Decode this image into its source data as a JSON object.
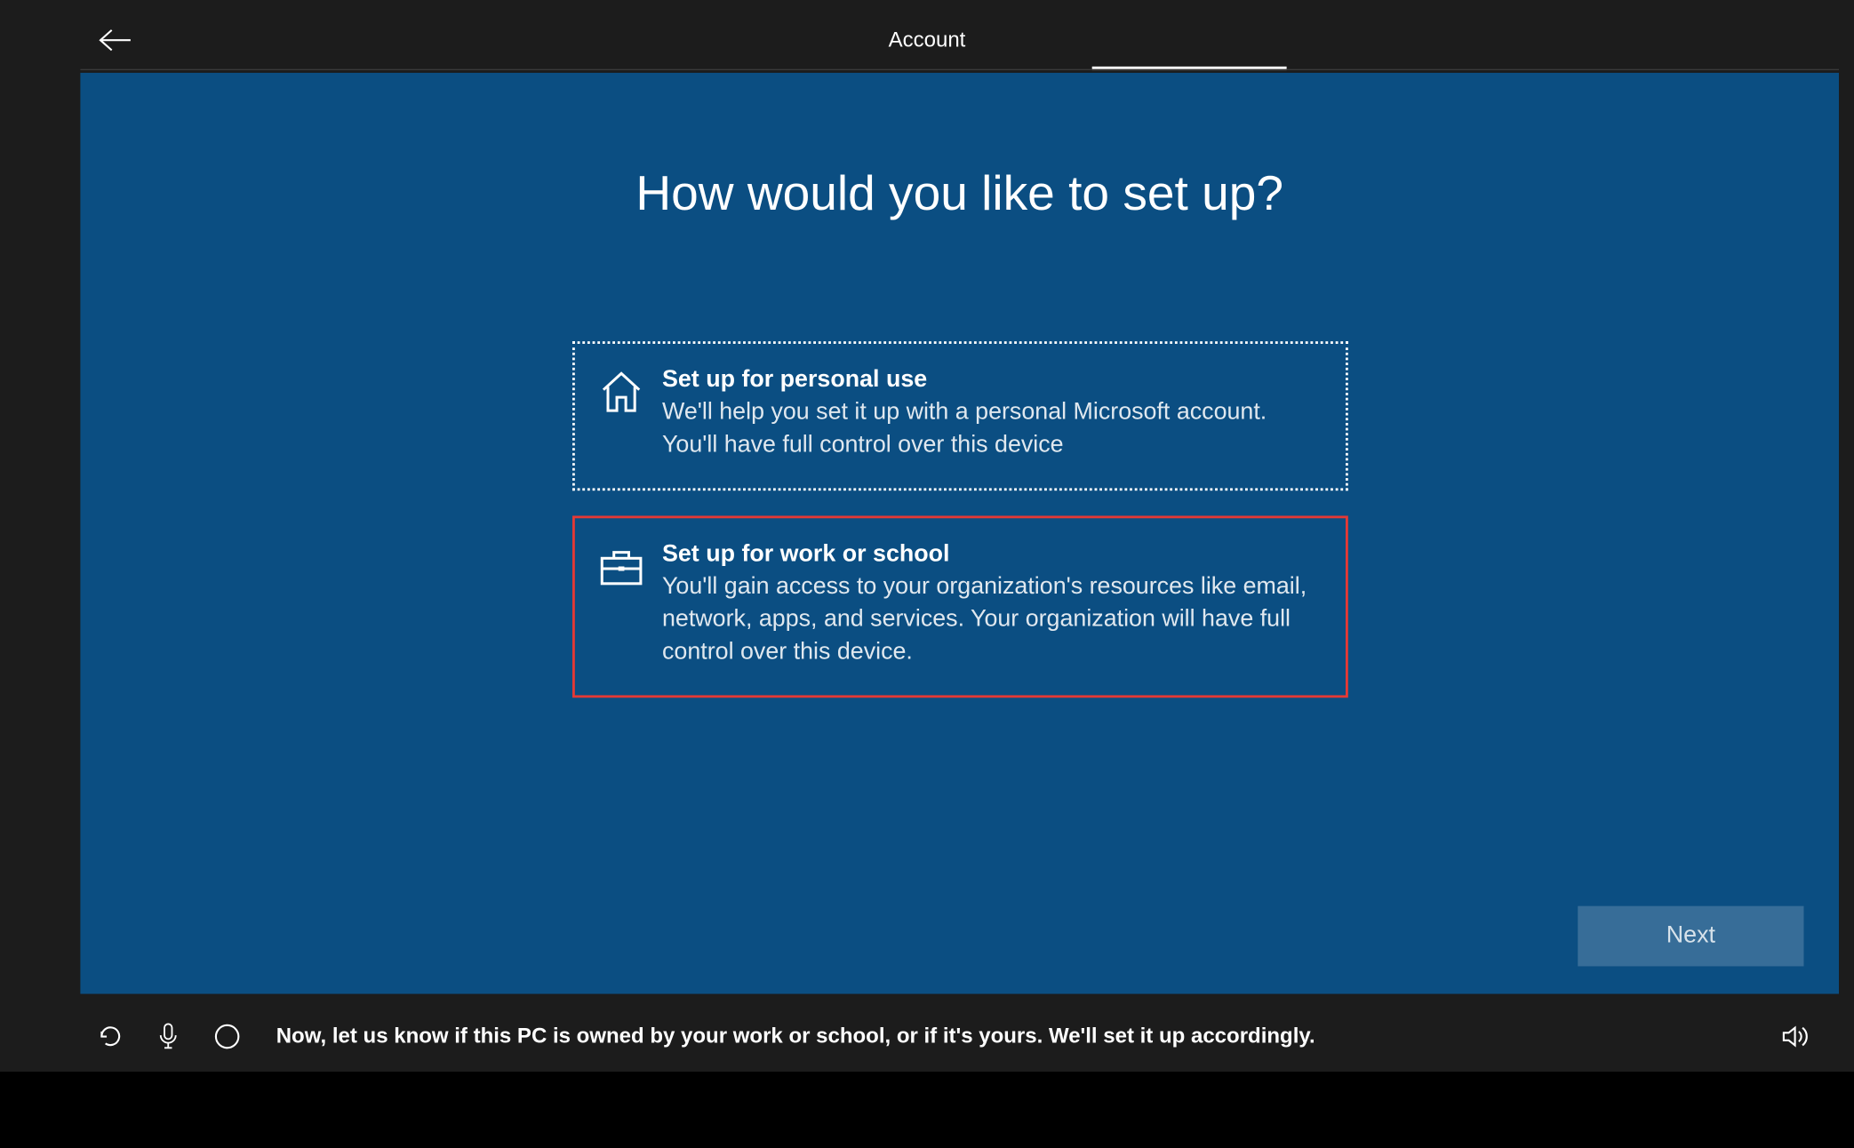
{
  "header": {
    "title": "Account"
  },
  "main": {
    "title": "How would you like to set up?",
    "options": [
      {
        "title": "Set up for personal use",
        "description": "We'll help you set it up with a personal Microsoft account. You'll have full control over this device"
      },
      {
        "title": "Set up for work or school",
        "description": "You'll gain access to your organization's resources like email, network, apps, and services. Your organization will have full control over this device."
      }
    ],
    "next_label": "Next"
  },
  "footer": {
    "cortana_text": "Now, let us know if this PC is owned by your work or school, or if it's yours. We'll set it up accordingly."
  }
}
